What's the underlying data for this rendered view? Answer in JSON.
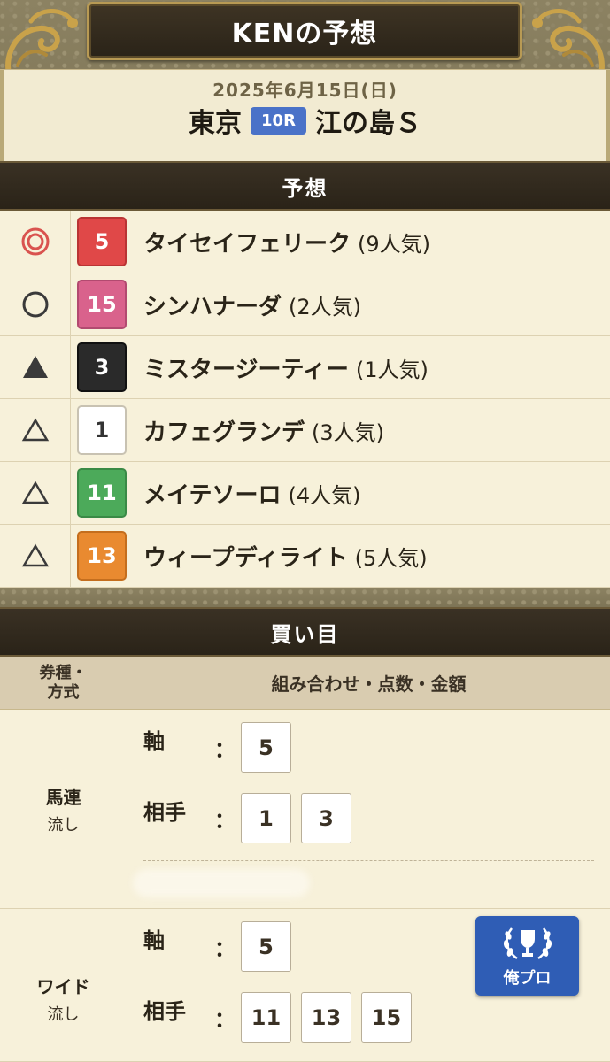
{
  "header": {
    "title": "KENの予想",
    "date": "2025年6月15日(日)",
    "venue": "東京",
    "race_no": "10R",
    "race_name": "江の島Ｓ"
  },
  "prediction": {
    "section_title": "予想",
    "rows": [
      {
        "mark": "double-circle",
        "number": "5",
        "color": "#e04848",
        "name": "タイセイフェリーク",
        "popularity": "(9人気)"
      },
      {
        "mark": "circle",
        "number": "15",
        "color": "#d9628c",
        "name": "シンハナーダ",
        "popularity": "(2人気)"
      },
      {
        "mark": "filled-triangle",
        "number": "3",
        "color": "#2a2a2a",
        "name": "ミスタージーティー",
        "popularity": "(1人気)"
      },
      {
        "mark": "triangle",
        "number": "1",
        "color": "#ffffff",
        "name": "カフェグランデ",
        "popularity": "(3人気)"
      },
      {
        "mark": "triangle",
        "number": "11",
        "color": "#4caa5a",
        "name": "メイテソーロ",
        "popularity": "(4人気)"
      },
      {
        "mark": "triangle",
        "number": "13",
        "color": "#e98a30",
        "name": "ウィープディライト",
        "popularity": "(5人気)"
      }
    ]
  },
  "bets": {
    "section_title": "買い目",
    "col_type_line1": "券種・",
    "col_type_line2": "方式",
    "col_combo": "組み合わせ・点数・金額",
    "rows": [
      {
        "type": "馬連",
        "method": "流し",
        "axis_label": "軸",
        "axis": [
          "5"
        ],
        "partner_label": "相手",
        "partners": [
          "1",
          "3"
        ]
      },
      {
        "type": "ワイド",
        "method": "流し",
        "axis_label": "軸",
        "axis": [
          "5"
        ],
        "partner_label": "相手",
        "partners": [
          "11",
          "13",
          "15"
        ]
      }
    ],
    "colon": "：",
    "pro_badge": "俺プロ"
  }
}
